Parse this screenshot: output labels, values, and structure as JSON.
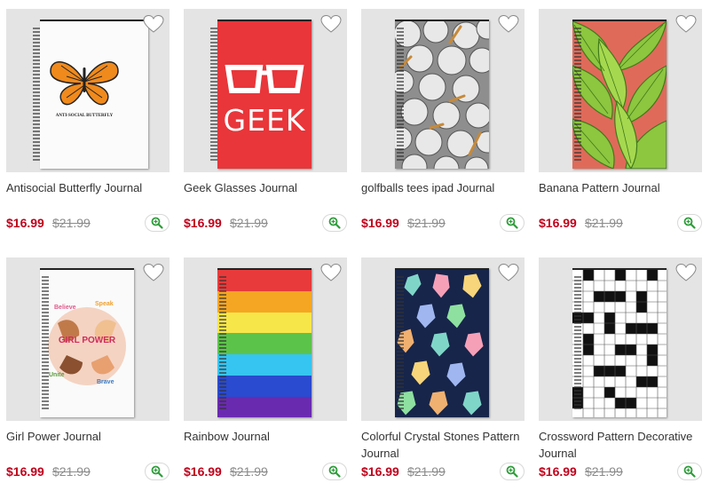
{
  "currency_note": "",
  "products": [
    {
      "title": "Antisocial Butterfly Journal",
      "sale_price": "$16.99",
      "original_price": "$21.99",
      "design_text": "ANTI-SOCIAL BUTTERFLY",
      "cover_color": "#ffffff",
      "icon": "butterfly-design"
    },
    {
      "title": "Geek Glasses Journal",
      "sale_price": "$16.99",
      "original_price": "$21.99",
      "design_text": "GEEK",
      "cover_color": "#e8363a",
      "icon": "glasses-design"
    },
    {
      "title": "golfballs tees ipad Journal",
      "sale_price": "$16.99",
      "original_price": "$21.99",
      "design_text": "",
      "cover_color": "#9a9a9a",
      "icon": "golfball-pattern"
    },
    {
      "title": "Banana Pattern Journal",
      "sale_price": "$16.99",
      "original_price": "$21.99",
      "design_text": "",
      "cover_color": "#5fa028",
      "icon": "banana-leaf-pattern"
    },
    {
      "title": "Girl Power Journal",
      "sale_price": "$16.99",
      "original_price": "$21.99",
      "design_text": "GIRL POWER",
      "cover_color": "#ffffff",
      "icon": "girl-power-design"
    },
    {
      "title": "Rainbow Journal",
      "sale_price": "$16.99",
      "original_price": "$21.99",
      "design_text": "",
      "cover_color": "#e83a3a",
      "icon": "rainbow-stripes"
    },
    {
      "title": "Colorful Crystal Stones Pattern Journal",
      "sale_price": "$16.99",
      "original_price": "$21.99",
      "design_text": "",
      "cover_color": "#17254a",
      "icon": "crystal-pattern"
    },
    {
      "title": "Crossword Pattern Decorative Journal",
      "sale_price": "$16.99",
      "original_price": "$21.99",
      "design_text": "",
      "cover_color": "#ffffff",
      "icon": "crossword-pattern"
    }
  ],
  "colors": {
    "sale": "#c0001b",
    "original": "#8c8c8c",
    "zoom_icon": "#2e9c3a",
    "thumb_bg": "#e4e4e4"
  }
}
